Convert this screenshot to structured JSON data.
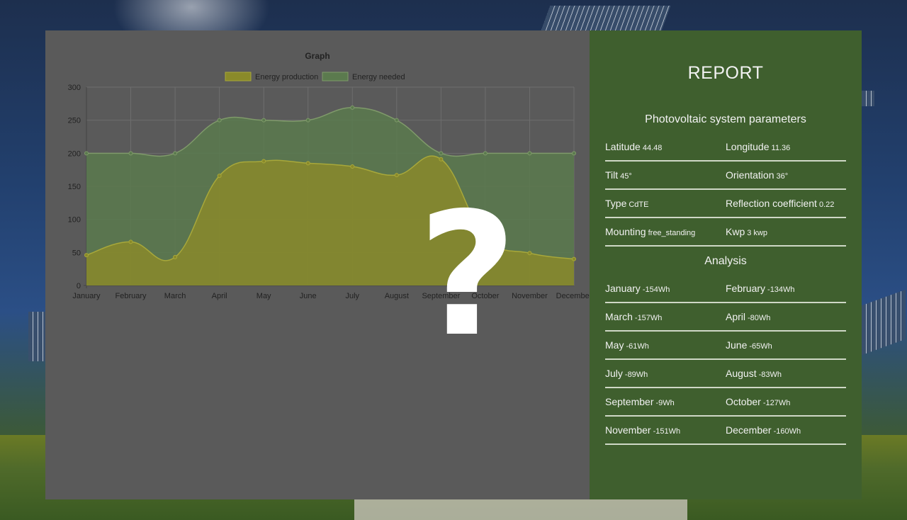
{
  "chart_data": {
    "type": "area",
    "title": "Graph",
    "categories": [
      "January",
      "February",
      "March",
      "April",
      "May",
      "June",
      "July",
      "August",
      "September",
      "October",
      "November",
      "December"
    ],
    "series": [
      {
        "name": "Energy production",
        "values": [
          46,
          66,
          43,
          166,
          188,
          185,
          180,
          167,
          191,
          73,
          49,
          40
        ],
        "fill": "#8a8a2a",
        "stroke": "#a8a83a"
      },
      {
        "name": "Energy needed",
        "values": [
          200,
          200,
          200,
          250,
          250,
          250,
          269,
          250,
          200,
          200,
          200,
          200
        ],
        "fill": "#5b7a4e",
        "stroke": "#7f9a6a"
      }
    ],
    "ylim": [
      0,
      300
    ],
    "yticks": [
      0,
      50,
      100,
      150,
      200,
      250,
      300
    ],
    "legend": "top",
    "grid": true
  },
  "report": {
    "title": "REPORT",
    "params_title": "Photovoltaic system parameters",
    "params": [
      {
        "label": "Latitude",
        "value": "44.48"
      },
      {
        "label": "Longitude",
        "value": "11.36"
      },
      {
        "label": "Tilt",
        "value": "45°"
      },
      {
        "label": "Orientation",
        "value": "36°"
      },
      {
        "label": "Type",
        "value": "CdTE"
      },
      {
        "label": "Reflection coefficient",
        "value": "0.22"
      },
      {
        "label": "Mounting",
        "value": "free_standing"
      },
      {
        "label": "Kwp",
        "value": "3 kwp"
      }
    ],
    "analysis_title": "Analysis",
    "analysis": [
      {
        "label": "January",
        "value": "-154Wh"
      },
      {
        "label": "February",
        "value": "-134Wh"
      },
      {
        "label": "March",
        "value": "-157Wh"
      },
      {
        "label": "April",
        "value": "-80Wh"
      },
      {
        "label": "May",
        "value": "-61Wh"
      },
      {
        "label": "June",
        "value": "-65Wh"
      },
      {
        "label": "July",
        "value": "-89Wh"
      },
      {
        "label": "August",
        "value": "-83Wh"
      },
      {
        "label": "September",
        "value": "-9Wh"
      },
      {
        "label": "October",
        "value": "-127Wh"
      },
      {
        "label": "November",
        "value": "-151Wh"
      },
      {
        "label": "December",
        "value": "-160Wh"
      }
    ]
  },
  "overlay": {
    "symbol": "?"
  }
}
